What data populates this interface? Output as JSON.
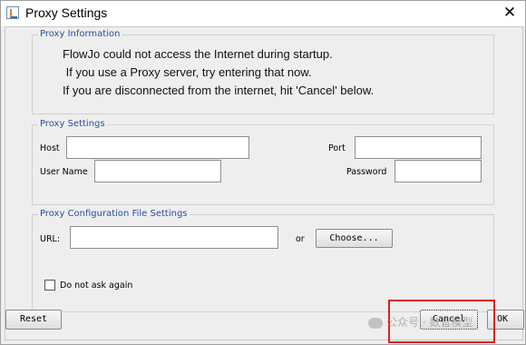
{
  "window": {
    "title": "Proxy Settings",
    "close_glyph": "✕"
  },
  "proxy_information": {
    "title": "Proxy Information",
    "lines": [
      "FlowJo could not access the Internet during startup.",
      " If you use a Proxy server, try entering that now.",
      "If you are disconnected from the internet, hit 'Cancel' below."
    ]
  },
  "proxy_settings": {
    "title": "Proxy Settings",
    "host_label": "Host",
    "host_value": "",
    "port_label": "Port",
    "port_value": "",
    "user_name_label": "User Name",
    "user_name_value": "",
    "password_label": "Password",
    "password_value": ""
  },
  "proxy_config": {
    "title": "Proxy Configuration File Settings",
    "url_label": "URL:",
    "url_value": "",
    "or_label": "or",
    "choose_label": "Choose..."
  },
  "do_not_ask": {
    "label": "Do not ask again",
    "checked": false
  },
  "buttons": {
    "reset": "Reset",
    "cancel": "Cancel",
    "ok": "OK"
  },
  "watermark": {
    "text": "公众号 · 数智模型"
  },
  "colors": {
    "group_title": "#2b4f9e",
    "highlight": "#e02020"
  }
}
